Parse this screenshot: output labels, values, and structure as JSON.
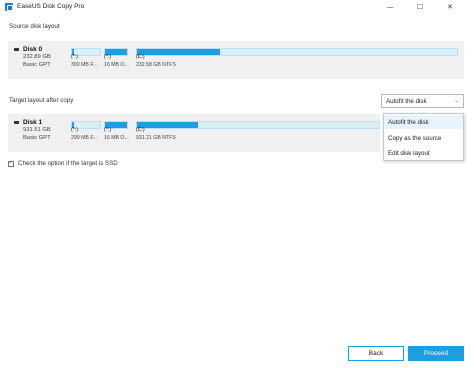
{
  "window": {
    "title": "EaseUS Disk Copy Pro",
    "controls": {
      "minimize": "—",
      "maximize": "☐",
      "close": "✕"
    },
    "icon": "app-icon"
  },
  "source": {
    "section_label": "Source disk layout",
    "disk": {
      "name": "Disk 0",
      "size": "232.89 GB",
      "type": "Basic GPT",
      "icon": "drive-icon",
      "partitions": [
        {
          "letter": "(*:)",
          "detail": "300 MB F...",
          "fill": 0.08
        },
        {
          "letter": "(*:)",
          "detail": "16 MB O...",
          "fill": 1.0
        },
        {
          "letter": "(C:)",
          "detail": "232.58 GB NTFS",
          "fill": 0.26
        }
      ]
    }
  },
  "target": {
    "section_label": "Target layout after copy",
    "dropdown": {
      "selected": "Autofit the disk",
      "chevron": "⌄",
      "options": [
        "Autofit the disk",
        "Copy as the source",
        "Edit disk layout"
      ]
    },
    "disk": {
      "name": "Disk 1",
      "size": "931.51 GB",
      "type": "Basic GPT",
      "icon": "drive-icon",
      "partitions": [
        {
          "letter": "(*:)",
          "detail": "299 MB F...",
          "fill": 0.08
        },
        {
          "letter": "(*:)",
          "detail": "16 MB O...",
          "fill": 1.0
        },
        {
          "letter": "(C:)",
          "detail": "931.21 GB NTFS",
          "fill": 0.25
        }
      ]
    }
  },
  "ssd_option": {
    "checked": true,
    "label": "Check the option if the target is SSD",
    "check_glyph": "✓"
  },
  "footer": {
    "back_label": "Back",
    "proceed_label": "Proceed"
  },
  "colors": {
    "accent": "#1c9fe0",
    "partition_empty": "#dbeefa",
    "panel_bg": "#f0f0f0"
  }
}
